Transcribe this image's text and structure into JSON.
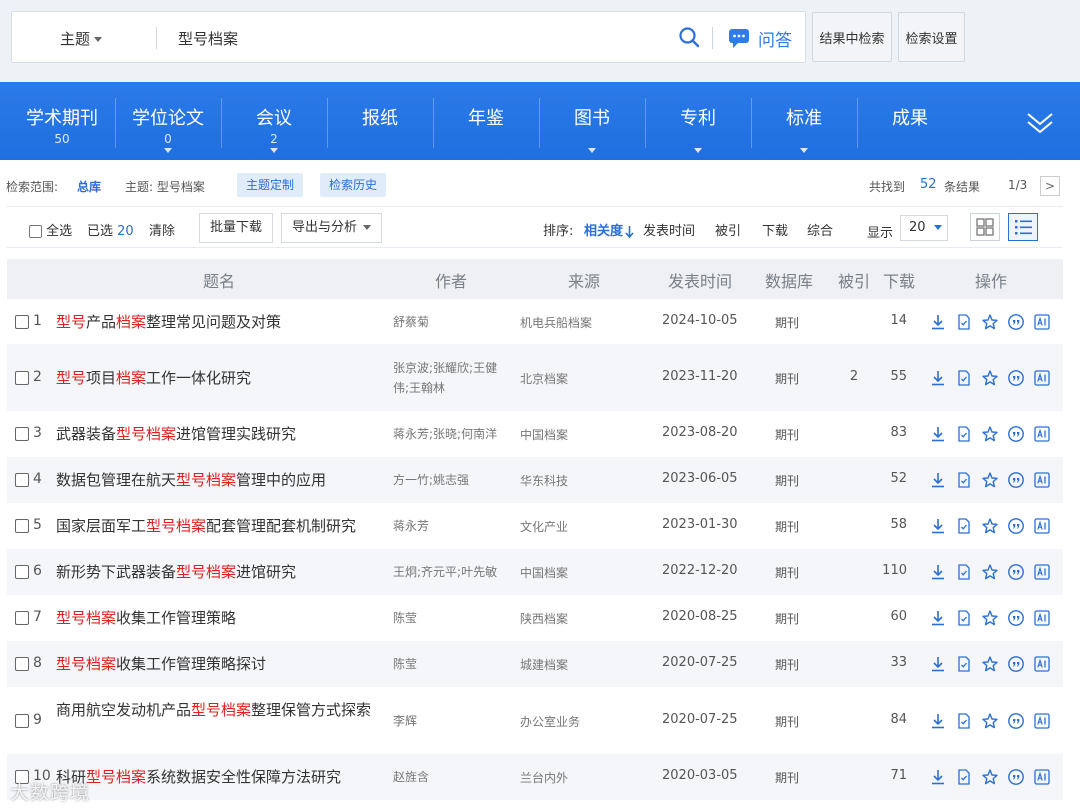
{
  "search": {
    "scope": "主题",
    "query": "型号档案",
    "qa_label": "问答",
    "search_within_label": "结果中检索",
    "settings_label": "检索设置"
  },
  "categories": [
    {
      "name": "学术期刊",
      "count": "50"
    },
    {
      "name": "学位论文",
      "count": "0"
    },
    {
      "name": "会议",
      "count": "2"
    },
    {
      "name": "报纸",
      "count": ""
    },
    {
      "name": "年鉴",
      "count": ""
    },
    {
      "name": "图书",
      "count": ""
    },
    {
      "name": "专利",
      "count": ""
    },
    {
      "name": "标准",
      "count": ""
    },
    {
      "name": "成果",
      "count": ""
    }
  ],
  "scope_line": {
    "range_label": "检索范围:",
    "range_value": "总库",
    "topic": "主题: 型号档案",
    "chip1": "主题定制",
    "chip2": "检索历史",
    "found_prefix": "共找到",
    "found_count": "52",
    "found_suffix": "条结果",
    "page": "1/3",
    "next_glyph": ">"
  },
  "toolbar": {
    "select_all": "全选",
    "selected_prefix": "已选",
    "selected_count": "20",
    "clear": "清除",
    "batch_download": "批量下载",
    "export_analysis": "导出与分析",
    "sort_label": "排序:",
    "sort_relevance": "相关度",
    "sort_date": "发表时间",
    "sort_cited": "被引",
    "sort_download": "下载",
    "sort_composite": "综合",
    "display_label": "显示",
    "page_size": "20"
  },
  "table": {
    "headers": {
      "title": "题名",
      "author": "作者",
      "source": "来源",
      "date": "发表时间",
      "database": "数据库",
      "cited": "被引",
      "downloads": "下载",
      "actions": "操作"
    },
    "rows": [
      {
        "num": "1",
        "title": [
          [
            "型号",
            "h"
          ],
          [
            "产品",
            ""
          ],
          [
            "档案",
            "h"
          ],
          [
            "整理常见问题及对策",
            ""
          ]
        ],
        "author": "舒蔡菊",
        "source": "机电兵船档案",
        "date": "2024-10-05",
        "database": "期刊",
        "cited": "",
        "downloads": "14"
      },
      {
        "num": "2",
        "title": [
          [
            "型号",
            "h"
          ],
          [
            "项目",
            ""
          ],
          [
            "档案",
            "h"
          ],
          [
            "工作一体化研究",
            ""
          ]
        ],
        "author": "张京波;张耀欣;王健伟;王翰林",
        "source": "北京档案",
        "date": "2023-11-20",
        "database": "期刊",
        "cited": "2",
        "downloads": "55"
      },
      {
        "num": "3",
        "title": [
          [
            "武器装备",
            ""
          ],
          [
            "型号档案",
            "h"
          ],
          [
            "进馆管理实践研究",
            ""
          ]
        ],
        "author": "蒋永芳;张晓;何南洋",
        "source": "中国档案",
        "date": "2023-08-20",
        "database": "期刊",
        "cited": "",
        "downloads": "83"
      },
      {
        "num": "4",
        "title": [
          [
            "数据包管理在航天",
            ""
          ],
          [
            "型号档案",
            "h"
          ],
          [
            "管理中的应用",
            ""
          ]
        ],
        "author": "方一竹;姚志强",
        "source": "华东科技",
        "date": "2023-06-05",
        "database": "期刊",
        "cited": "",
        "downloads": "52"
      },
      {
        "num": "5",
        "title": [
          [
            "国家层面军工",
            ""
          ],
          [
            "型号档案",
            "h"
          ],
          [
            "配套管理配套机制研究",
            ""
          ]
        ],
        "author": "蒋永芳",
        "source": "文化产业",
        "date": "2023-01-30",
        "database": "期刊",
        "cited": "",
        "downloads": "58"
      },
      {
        "num": "6",
        "title": [
          [
            "新形势下武器装备",
            ""
          ],
          [
            "型号档案",
            "h"
          ],
          [
            "进馆研究",
            ""
          ]
        ],
        "author": "王炯;齐元平;叶先敏",
        "source": "中国档案",
        "date": "2022-12-20",
        "database": "期刊",
        "cited": "",
        "downloads": "110"
      },
      {
        "num": "7",
        "title": [
          [
            "型号档案",
            "h"
          ],
          [
            "收集工作管理策略",
            ""
          ]
        ],
        "author": "陈莹",
        "source": "陕西档案",
        "date": "2020-08-25",
        "database": "期刊",
        "cited": "",
        "downloads": "60"
      },
      {
        "num": "8",
        "title": [
          [
            "型号档案",
            "h"
          ],
          [
            "收集工作管理策略探讨",
            ""
          ]
        ],
        "author": "陈莹",
        "source": "城建档案",
        "date": "2020-07-25",
        "database": "期刊",
        "cited": "",
        "downloads": "33"
      },
      {
        "num": "9",
        "title": [
          [
            "商用航空发动机产品",
            ""
          ],
          [
            "型号档案",
            "h"
          ],
          [
            "整理保管方式探索",
            ""
          ]
        ],
        "author": "李辉",
        "source": "办公室业务",
        "date": "2020-07-25",
        "database": "期刊",
        "cited": "",
        "downloads": "84"
      },
      {
        "num": "10",
        "title": [
          [
            "科研",
            ""
          ],
          [
            "型号档案",
            "h"
          ],
          [
            "系统数据安全性保障方法研究",
            ""
          ]
        ],
        "author": "赵旌含",
        "source": "兰台内外",
        "date": "2020-03-05",
        "database": "期刊",
        "cited": "",
        "downloads": "71"
      }
    ]
  },
  "action_icons": [
    "download-icon",
    "html-read-icon",
    "favorite-star-icon",
    "quote-icon",
    "ai-icon"
  ],
  "watermark": "大数跨境",
  "colors": {
    "brand_blue": "#1f6fe0",
    "highlight_red": "#e02020",
    "link_blue": "#2a6fd6"
  }
}
